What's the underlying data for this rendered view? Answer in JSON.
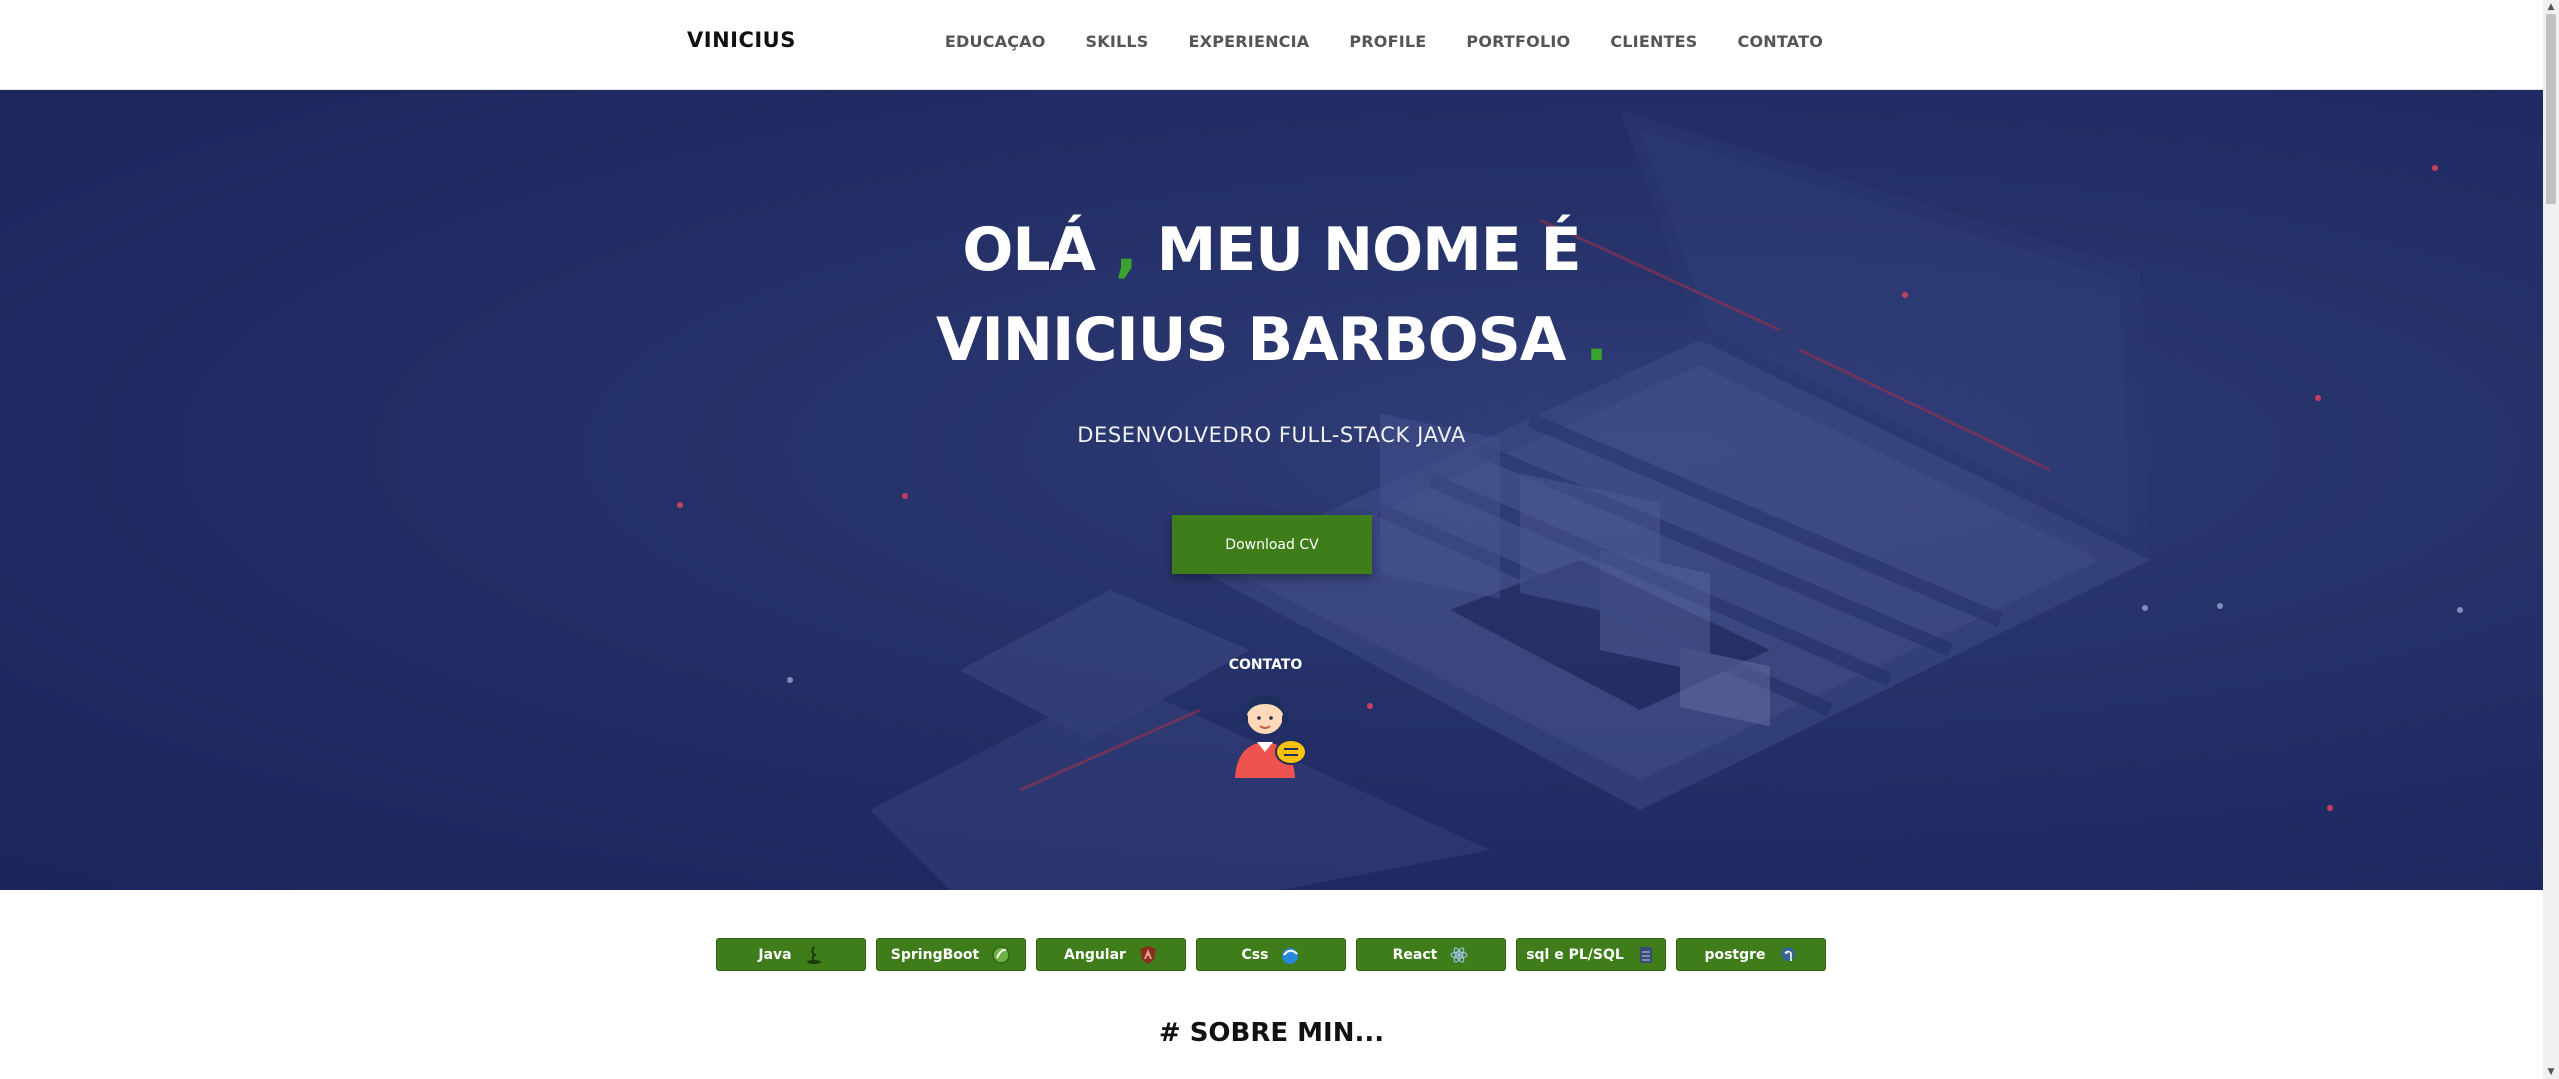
{
  "nav": {
    "brand": "VINICIUS",
    "links": [
      "EDUCAÇAO",
      "SKILLS",
      "EXPERIENCIA",
      "PROFILE",
      "PORTFOLIO",
      "CLIENTES",
      "CONTATO"
    ]
  },
  "hero": {
    "line1_a": "OLÁ",
    "line1_accent": " , ",
    "line1_b": "MEU NOME É",
    "line2_a": "VINICIUS BARBOSA",
    "line2_accent": " .",
    "subtitle": "DESENVOLVEDRO FULL-STACK JAVA",
    "download_label": "Download CV",
    "contact_label": "CONTATO"
  },
  "skills": [
    "Java",
    "SpringBoot",
    "Angular",
    "Css",
    "React",
    "sql e PL/SQL",
    "postgre"
  ],
  "about": {
    "title": "# SOBRE MIN..."
  },
  "colors": {
    "accent_green": "#3aa32e",
    "button_green": "#3e7d1a",
    "hero_blue": "#2d3a73"
  }
}
